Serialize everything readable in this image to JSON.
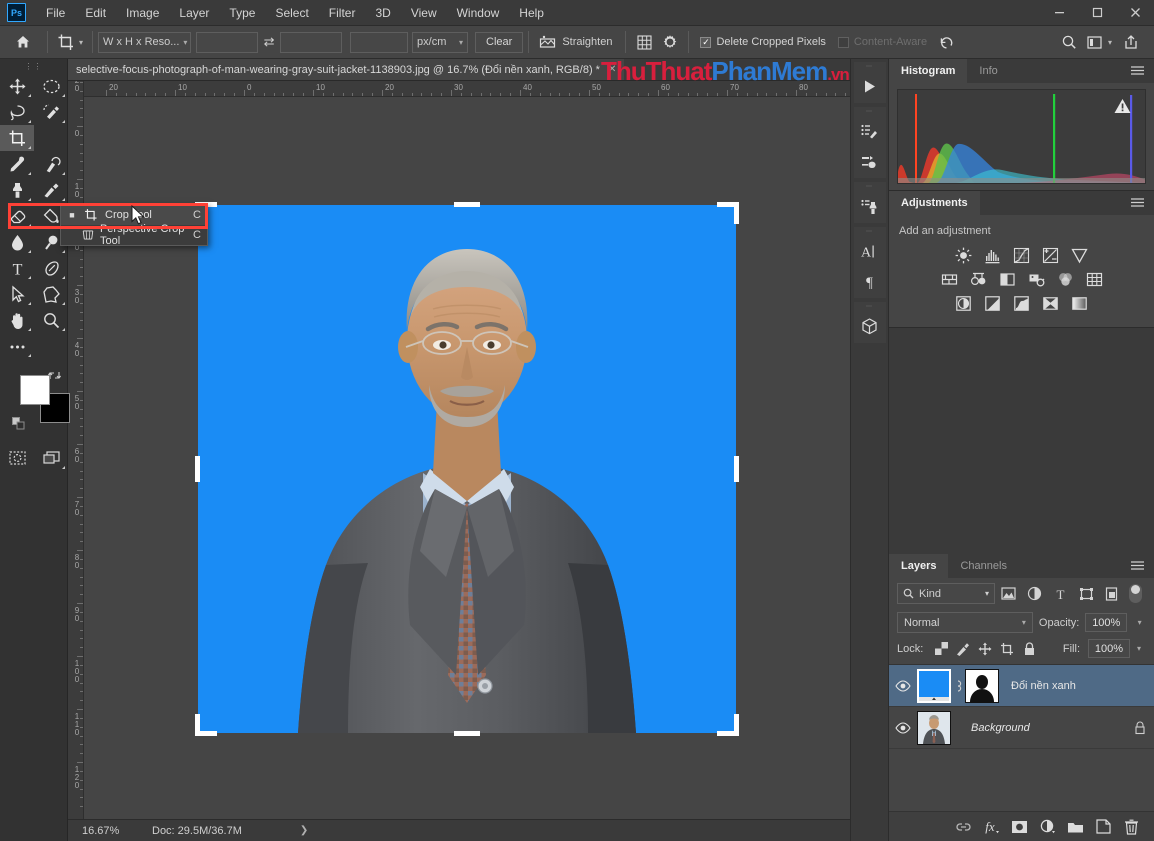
{
  "app": {
    "logo": "Ps",
    "menus": [
      "File",
      "Edit",
      "Image",
      "Layer",
      "Type",
      "Select",
      "Filter",
      "3D",
      "View",
      "Window",
      "Help"
    ],
    "window_controls": {
      "minimize": "—",
      "maximize": "▭",
      "close": "✕"
    }
  },
  "options_bar": {
    "home_icon": "home-icon",
    "tool_icon": "crop-tool-icon",
    "preset_chevron": "▾",
    "ratio_select": "W x H x Reso...",
    "width_value": "",
    "height_value": "",
    "resolution_value": "",
    "swap_icon": "⇄",
    "unit_select": "px/cm",
    "clear_label": "Clear",
    "straighten_icon": "straighten-icon",
    "straighten_label": "Straighten",
    "overlay_icon": "grid-overlay-icon",
    "settings_icon": "gear-icon",
    "delete_cropped_label": "Delete Cropped Pixels",
    "delete_cropped_checked": true,
    "content_aware_label": "Content-Aware",
    "content_aware_checked": false,
    "content_aware_disabled": true,
    "reset_icon": "reset-icon",
    "search_icon": "search-icon",
    "workspace_icon": "workspace-icon",
    "workspace_chevron": "▾",
    "share_icon": "share-icon"
  },
  "toolbar": {
    "grip": "⋮⋮",
    "tools": [
      {
        "name": "move-tool",
        "row": 0,
        "col": 0
      },
      {
        "name": "marquee-tool",
        "row": 0,
        "col": 1
      },
      {
        "name": "lasso-tool",
        "row": 1,
        "col": 0
      },
      {
        "name": "quick-selection-tool",
        "row": 1,
        "col": 1
      },
      {
        "name": "crop-tool",
        "row": 2,
        "col": 0,
        "active": true
      },
      {
        "name": "eyedropper-tool",
        "row": 3,
        "col": 0
      },
      {
        "name": "spot-healing-tool",
        "row": 3,
        "col": 1
      },
      {
        "name": "clone-stamp-tool",
        "row": 4,
        "col": 0
      },
      {
        "name": "history-brush-tool",
        "row": 4,
        "col": 1
      },
      {
        "name": "eraser-tool",
        "row": 5,
        "col": 0
      },
      {
        "name": "gradient-tool",
        "row": 5,
        "col": 1
      },
      {
        "name": "blur-tool",
        "row": 6,
        "col": 0
      },
      {
        "name": "dodge-tool",
        "row": 6,
        "col": 1
      },
      {
        "name": "type-tool",
        "row": 7,
        "col": 0
      },
      {
        "name": "pen-tool",
        "row": 7,
        "col": 1
      },
      {
        "name": "path-selection-tool",
        "row": 8,
        "col": 0
      },
      {
        "name": "shape-tool",
        "row": 8,
        "col": 1
      },
      {
        "name": "hand-tool",
        "row": 9,
        "col": 0
      },
      {
        "name": "zoom-tool",
        "row": 9,
        "col": 1
      },
      {
        "name": "edit-toolbar-tool",
        "row": 10,
        "col": 0
      }
    ],
    "foreground_color": "#ffffff",
    "background_color": "#000000",
    "quickmask_icon": "quick-mask-icon",
    "screenmode_icon": "screen-mode-icon"
  },
  "flyout": {
    "items": [
      {
        "label": "Crop Tool",
        "shortcut": "C",
        "selected": true,
        "icon": "crop-tool-icon"
      },
      {
        "label": "Perspective Crop Tool",
        "shortcut": "C",
        "selected": false,
        "icon": "perspective-crop-tool-icon"
      }
    ],
    "highlight_color": "#ff4136"
  },
  "document": {
    "tab_title": "selective-focus-photograph-of-man-wearing-gray-suit-jacket-1138903.jpg @ 16.7%  (Đổi nền xanh, RGB/8) *",
    "tab_close": "✕",
    "watermark": {
      "part1": "ThuThuat",
      "part2": "PhanMem",
      "part3": ".vn"
    },
    "ruler_h_ticks": [
      "20",
      "10",
      "0",
      "10",
      "20",
      "30",
      "40",
      "50",
      "60",
      "70",
      "80"
    ],
    "ruler_v_ticks": [
      "20",
      "0",
      "10",
      "20",
      "30",
      "40",
      "50",
      "60",
      "70",
      "80",
      "90",
      "100",
      "110",
      "120"
    ],
    "canvas_bg_color": "#1a8cf5"
  },
  "status_bar": {
    "zoom": "16.67%",
    "doc_info": "Doc: 29.5M/36.7M",
    "expand_arrow": "❯"
  },
  "icon_dock": {
    "groups": [
      {
        "icons": [
          "actions-play-icon"
        ]
      },
      {
        "icons": [
          "brush-settings-icon",
          "brush-presets-icon"
        ]
      },
      {
        "icons": [
          "clone-source-icon"
        ]
      },
      {
        "icons": [
          "character-icon",
          "paragraph-icon"
        ]
      },
      {
        "icons": [
          "3d-icon"
        ]
      }
    ]
  },
  "histogram_panel": {
    "tabs": [
      {
        "label": "Histogram",
        "active": true
      },
      {
        "label": "Info",
        "active": false
      }
    ],
    "menu_icon": "panel-menu-icon",
    "warning_icon": "warning-icon"
  },
  "adjustments_panel": {
    "tabs": [
      {
        "label": "Adjustments",
        "active": true
      }
    ],
    "menu_icon": "panel-menu-icon",
    "hint": "Add an adjustment",
    "rows": [
      [
        "brightness-contrast-icon",
        "levels-icon",
        "curves-icon",
        "exposure-icon",
        "vibrance-icon"
      ],
      [
        "color-balance-icon",
        "black-white-icon",
        "photo-filter-icon",
        "channel-mixer-icon",
        "color-lookup-icon",
        "posterize-icon"
      ],
      [
        "invert-icon",
        "threshold-icon",
        "selective-color-icon",
        "gradient-map-icon",
        "gradient-fill-icon"
      ]
    ]
  },
  "layers_panel": {
    "tabs": [
      {
        "label": "Layers",
        "active": true
      },
      {
        "label": "Channels",
        "active": false
      }
    ],
    "menu_icon": "panel-menu-icon",
    "filter_label": "Kind",
    "filter_search_icon": "search-icon",
    "filter_chevron": "▾",
    "filter_icons": [
      "filter-pixel-icon",
      "filter-adjustment-icon",
      "filter-type-icon",
      "filter-shape-icon",
      "filter-smart-icon"
    ],
    "filter_toggle": "filter-toggle",
    "blend_mode": "Normal",
    "blend_chevron": "▾",
    "opacity_label": "Opacity:",
    "opacity_value": "100%",
    "lock_label": "Lock:",
    "lock_icons": [
      "lock-transparent-icon",
      "lock-image-icon",
      "lock-position-icon",
      "lock-artboard-icon",
      "lock-all-icon"
    ],
    "fill_label": "Fill:",
    "fill_value": "100%",
    "layers": [
      {
        "name": "Đổi nền xanh",
        "selected": true,
        "visible": true,
        "locked": false,
        "italic": false,
        "has_mask": true,
        "linked": true,
        "thumb_color": "#1a8cf5"
      },
      {
        "name": "Background",
        "selected": false,
        "visible": true,
        "locked": true,
        "italic": true,
        "has_mask": false,
        "linked": false,
        "thumb_color": "#9fb4c4"
      }
    ],
    "bottom_icons": [
      "link-layers-icon",
      "fx-icon",
      "add-mask-icon",
      "adjustment-layer-icon",
      "new-group-icon",
      "new-layer-icon",
      "delete-layer-icon"
    ]
  }
}
